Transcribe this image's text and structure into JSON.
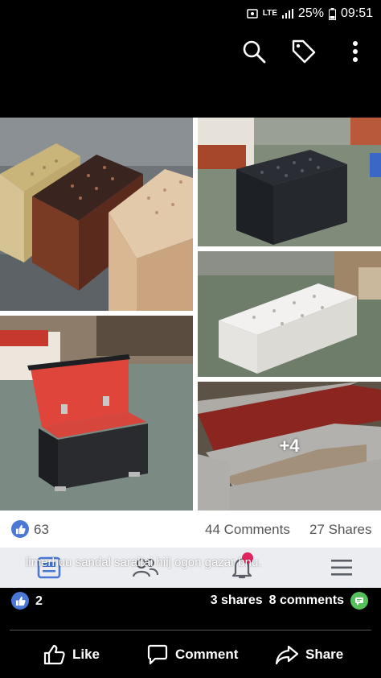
{
  "status_bar": {
    "network": "LTE",
    "battery": "25%",
    "time": "09:51"
  },
  "top_bar": {
    "icons": [
      "search-icon",
      "tag-icon",
      "more-vertical-icon"
    ]
  },
  "gallery": {
    "more_count": "+4"
  },
  "reactions": {
    "count": "63",
    "comments": "44 Comments",
    "shares": "27 Shares"
  },
  "nav_overlay": {
    "caption": "limerhuu sandal saraltai hiij ogon gazar bnu."
  },
  "share_row": {
    "likes": "2",
    "shares": "3 shares",
    "comments": "8 comments"
  },
  "actions": {
    "like": "Like",
    "comment": "Comment",
    "share": "Share"
  },
  "colors": {
    "facebook_blue": "#4a78d6",
    "comment_green": "#55c15b",
    "notification_red": "#e0245e"
  }
}
